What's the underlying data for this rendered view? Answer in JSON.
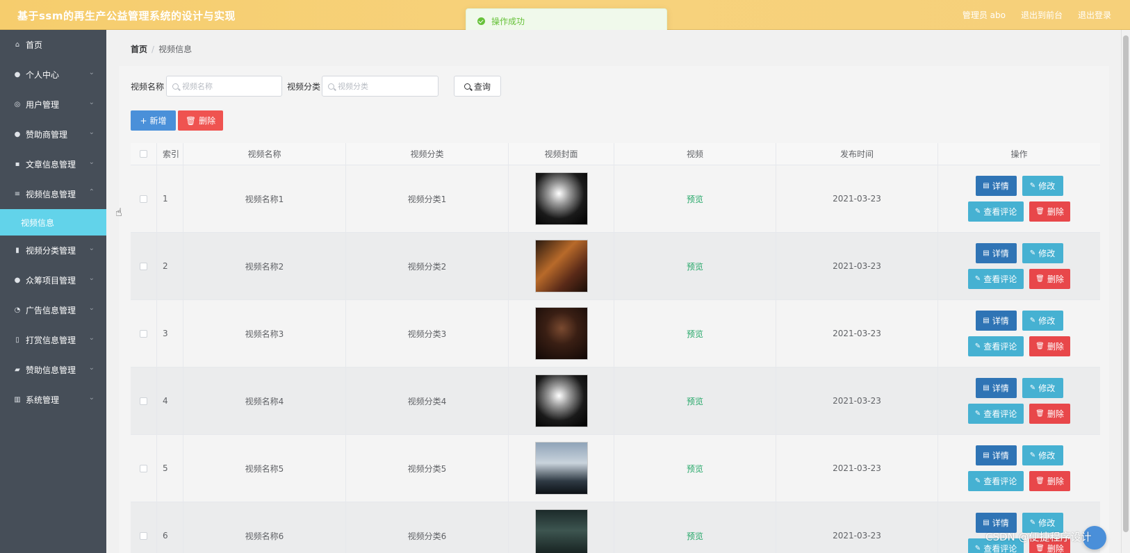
{
  "header": {
    "title": "基于ssm的再生产公益管理系统的设计与实现",
    "user_label": "管理员 abo",
    "goto_front_label": "退出到前台",
    "logout_label": "退出登录"
  },
  "toast": {
    "message": "操作成功"
  },
  "sidebar": {
    "items": [
      {
        "label": "首页",
        "icon": "home-icon"
      },
      {
        "label": "个人中心",
        "icon": "user-icon"
      },
      {
        "label": "用户管理",
        "icon": "globe-icon"
      },
      {
        "label": "赞助商管理",
        "icon": "bulb-icon"
      },
      {
        "label": "文章信息管理",
        "icon": "briefcase-icon"
      },
      {
        "label": "视频信息管理",
        "icon": "list-icon"
      },
      {
        "label": "视频分类管理",
        "icon": "clipboard-icon"
      },
      {
        "label": "众筹项目管理",
        "icon": "user-icon"
      },
      {
        "label": "广告信息管理",
        "icon": "dashboard-icon"
      },
      {
        "label": "打赏信息管理",
        "icon": "microphone-icon"
      },
      {
        "label": "赞助信息管理",
        "icon": "chart-icon"
      },
      {
        "label": "系统管理",
        "icon": "bar-chart-icon"
      }
    ],
    "active_sub": "视频信息"
  },
  "breadcrumb": {
    "home": "首页",
    "current": "视频信息"
  },
  "search": {
    "name_label": "视频名称",
    "name_placeholder": "视频名称",
    "category_label": "视频分类",
    "category_placeholder": "视频分类",
    "query_label": "查询"
  },
  "actions": {
    "add_label": "新增",
    "delete_label": "删除"
  },
  "table": {
    "columns": [
      "索引",
      "视频名称",
      "视频分类",
      "视频封面",
      "视频",
      "发布时间",
      "操作"
    ],
    "rows": [
      {
        "index": "1",
        "name": "视频名称1",
        "category": "视频分类1",
        "video": "预览",
        "time": "2021-03-23"
      },
      {
        "index": "2",
        "name": "视频名称2",
        "category": "视频分类2",
        "video": "预览",
        "time": "2021-03-23"
      },
      {
        "index": "3",
        "name": "视频名称3",
        "category": "视频分类3",
        "video": "预览",
        "time": "2021-03-23"
      },
      {
        "index": "4",
        "name": "视频名称4",
        "category": "视频分类4",
        "video": "预览",
        "time": "2021-03-23"
      },
      {
        "index": "5",
        "name": "视频名称5",
        "category": "视频分类5",
        "video": "预览",
        "time": "2021-03-23"
      },
      {
        "index": "6",
        "name": "视频名称6",
        "category": "视频分类6",
        "video": "预览",
        "time": "2021-03-23"
      }
    ],
    "row_ops": {
      "detail": "详情",
      "edit": "修改",
      "comment": "查看评论",
      "delete": "删除"
    }
  },
  "watermark": "CSDN @便捷程序设计",
  "colors": {
    "topbar": "#f6cd6d",
    "sidebar": "#464e58",
    "active_sub": "#62d3ea",
    "primary": "#4a90d9",
    "danger": "#ef5350"
  }
}
